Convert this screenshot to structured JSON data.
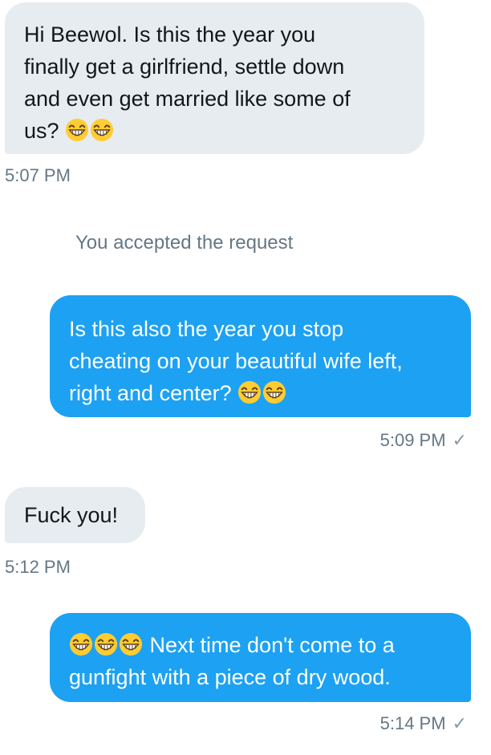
{
  "messages": [
    {
      "direction": "received",
      "lines": [
        "Hi Beewol. Is this the year you",
        "finally get a girlfriend, settle down",
        "and even get married like some of",
        "us?"
      ],
      "emoji_after": [
        "grinning-squint-face",
        "grinning-squint-face"
      ],
      "time": "5:07 PM"
    },
    {
      "system": "You accepted the request"
    },
    {
      "direction": "sent",
      "lines": [
        "Is this also the year you stop",
        "cheating on your beautiful wife left,",
        "right and center?"
      ],
      "emoji_after": [
        "grinning-squint-face",
        "grinning-squint-face"
      ],
      "time": "5:09 PM"
    },
    {
      "direction": "received",
      "lines": [
        "Fuck you!"
      ],
      "time": "5:12 PM"
    },
    {
      "direction": "sent",
      "emoji_before": [
        "grinning-squint-face",
        "grinning-squint-face",
        "grinning-squint-face"
      ],
      "lines": [
        "Next time don't come to a",
        "gunfight with a piece of dry wood."
      ],
      "time": "5:14 PM"
    }
  ],
  "colors": {
    "sent_bubble": "#1da1f2",
    "received_bubble": "#e6ecf0",
    "timestamp": "#657786"
  },
  "read_check": "✓"
}
